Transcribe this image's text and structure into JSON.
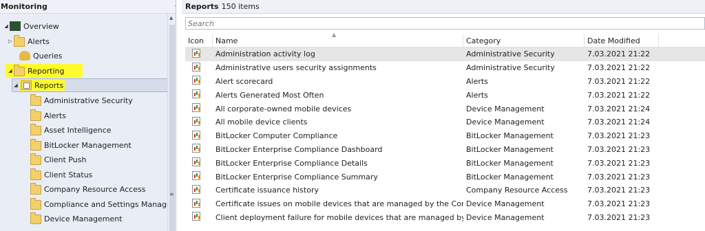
{
  "nav": {
    "title": "Monitoring",
    "items": [
      {
        "label": "Overview",
        "icon": "monitor-icon"
      },
      {
        "label": "Alerts",
        "icon": "folder-icon"
      },
      {
        "label": "Queries",
        "icon": "query-icon"
      },
      {
        "label": "Reporting",
        "icon": "folder-icon"
      },
      {
        "label": "Reports",
        "icon": "report-folder-icon"
      },
      {
        "label": "Administrative Security",
        "icon": "folder-icon"
      },
      {
        "label": "Alerts",
        "icon": "folder-icon"
      },
      {
        "label": "Asset Intelligence",
        "icon": "folder-icon"
      },
      {
        "label": "BitLocker Management",
        "icon": "folder-icon"
      },
      {
        "label": "Client Push",
        "icon": "folder-icon"
      },
      {
        "label": "Client Status",
        "icon": "folder-icon"
      },
      {
        "label": "Company Resource Access",
        "icon": "folder-icon"
      },
      {
        "label": "Compliance and Settings Management",
        "icon": "folder-icon"
      },
      {
        "label": "Device Management",
        "icon": "folder-icon"
      }
    ]
  },
  "content": {
    "title": "Reports",
    "count": "150 items",
    "search_placeholder": "Search",
    "columns": {
      "icon": "Icon",
      "name": "Name",
      "category": "Category",
      "date": "Date Modified"
    },
    "rows": [
      {
        "name": "Administration activity log",
        "category": "Administrative Security",
        "date": "7.03.2021 21:22"
      },
      {
        "name": "Administrative users security assignments",
        "category": "Administrative Security",
        "date": "7.03.2021 21:22"
      },
      {
        "name": "Alert scorecard",
        "category": "Alerts",
        "date": "7.03.2021 21:22"
      },
      {
        "name": "Alerts Generated Most Often",
        "category": "Alerts",
        "date": "7.03.2021 21:22"
      },
      {
        "name": "All corporate-owned mobile devices",
        "category": "Device Management",
        "date": "7.03.2021 21:24"
      },
      {
        "name": "All mobile device clients",
        "category": "Device Management",
        "date": "7.03.2021 21:24"
      },
      {
        "name": "BitLocker Computer Compliance",
        "category": "BitLocker Management",
        "date": "7.03.2021 21:23"
      },
      {
        "name": "BitLocker Enterprise Compliance Dashboard",
        "category": "BitLocker Management",
        "date": "7.03.2021 21:23"
      },
      {
        "name": "BitLocker Enterprise Compliance Details",
        "category": "BitLocker Management",
        "date": "7.03.2021 21:23"
      },
      {
        "name": "BitLocker Enterprise Compliance Summary",
        "category": "BitLocker Management",
        "date": "7.03.2021 21:23"
      },
      {
        "name": "Certificate issuance history",
        "category": "Company Resource Access",
        "date": "7.03.2021 21:23"
      },
      {
        "name": "Certificate issues on mobile devices that are managed by the Configura...",
        "category": "Device Management",
        "date": "7.03.2021 21:23"
      },
      {
        "name": "Client deployment failure for mobile devices that are managed by the C...",
        "category": "Device Management",
        "date": "7.03.2021 21:23"
      }
    ]
  }
}
